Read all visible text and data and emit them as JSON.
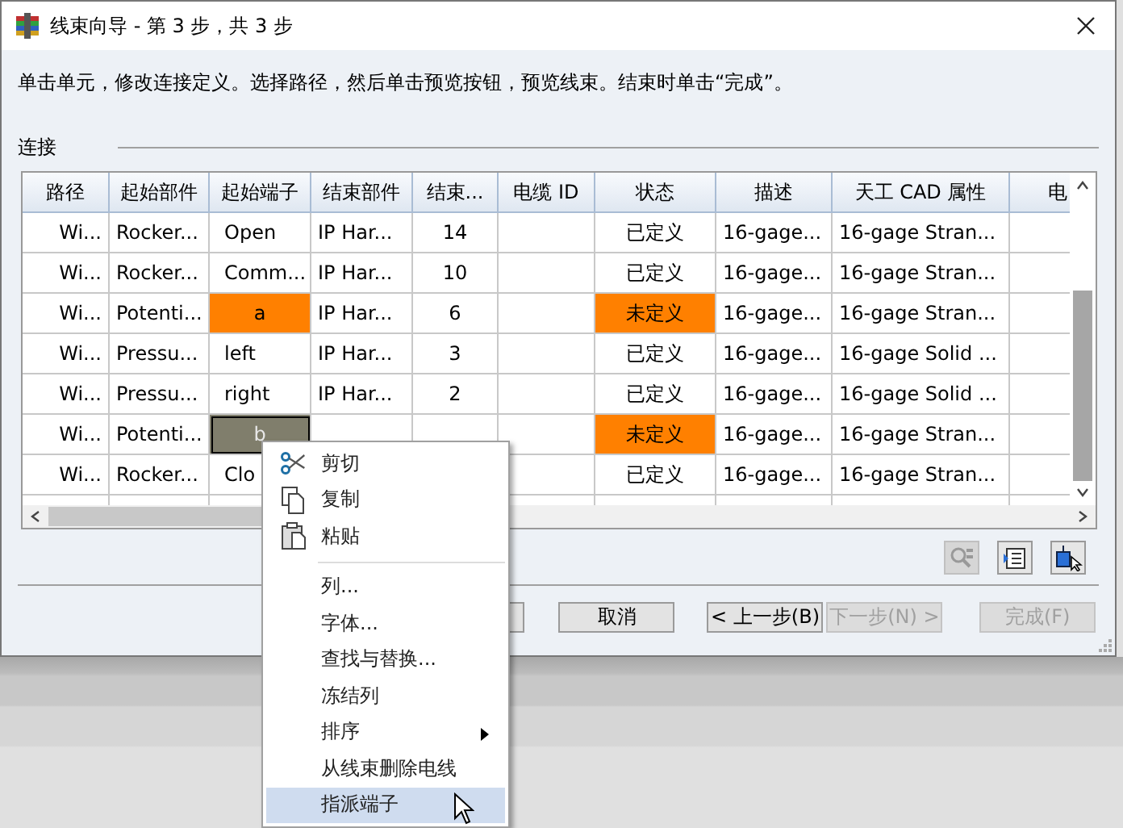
{
  "window": {
    "title": "线束向导 - 第 3 步，共 3 步"
  },
  "instruction": "单击单元，修改连接定义。选择路径，然后单击预览按钮，预览线束。结束时单击“完成”。",
  "section_label": "连接",
  "table": {
    "columns": [
      "路径",
      "起始部件",
      "起始端子",
      "结束部件",
      "结束...",
      "电缆 ID",
      "状态",
      "描述",
      "天工 CAD 属性",
      "电"
    ],
    "rows": [
      {
        "selected": false,
        "defined": true,
        "cells": [
          "Wi...",
          "Rocker...",
          "Open",
          "IP Har...",
          "14",
          "",
          "已定义",
          "16-gage...",
          "16-gage Stran...",
          ""
        ]
      },
      {
        "selected": false,
        "defined": true,
        "cells": [
          "Wi...",
          "Rocker...",
          "Comm...",
          "IP Har...",
          "10",
          "",
          "已定义",
          "16-gage...",
          "16-gage Stran...",
          ""
        ]
      },
      {
        "selected": false,
        "defined": false,
        "cells": [
          "Wi...",
          "Potenti...",
          "a",
          "IP Har...",
          "6",
          "",
          "未定义",
          "16-gage...",
          "16-gage Stran...",
          ""
        ]
      },
      {
        "selected": false,
        "defined": true,
        "cells": [
          "Wi...",
          "Pressu...",
          "left",
          "IP Har...",
          "3",
          "",
          "已定义",
          "16-gage...",
          "16-gage Solid ...",
          ""
        ]
      },
      {
        "selected": false,
        "defined": true,
        "cells": [
          "Wi...",
          "Pressu...",
          "right",
          "IP Har...",
          "2",
          "",
          "已定义",
          "16-gage...",
          "16-gage Solid ...",
          ""
        ]
      },
      {
        "selected": true,
        "defined": false,
        "cells": [
          "Wi...",
          "Potenti...",
          "b",
          null,
          null,
          "",
          "未定义",
          "16-gage...",
          "16-gage Stran...",
          ""
        ]
      },
      {
        "selected": false,
        "defined": true,
        "cells": [
          "Wi...",
          "Rocker...",
          "Clo",
          null,
          null,
          "",
          "已定义",
          "16-gage...",
          "16-gage Stran...",
          ""
        ]
      }
    ]
  },
  "buttons": [
    {
      "label": "取消",
      "disabled": false
    },
    {
      "label": "< 上一步(B)",
      "disabled": false
    },
    {
      "label": "下一步(N) >",
      "disabled": true
    },
    {
      "label": "完成(F)",
      "disabled": true
    }
  ],
  "context_menu": {
    "groups": [
      [
        {
          "label": "剪切",
          "selected": false,
          "submenu": false
        },
        {
          "label": "复制",
          "selected": false,
          "submenu": false
        },
        {
          "label": "粘贴",
          "selected": false,
          "submenu": false
        }
      ],
      [
        {
          "label": "列...",
          "selected": false,
          "submenu": false
        },
        {
          "label": "字体...",
          "selected": false,
          "submenu": false
        },
        {
          "label": "查找与替换...",
          "selected": false,
          "submenu": false
        },
        {
          "label": "冻结列",
          "selected": false,
          "submenu": false
        },
        {
          "label": "排序",
          "selected": false,
          "submenu": true
        },
        {
          "label": "从线束删除电线",
          "selected": false,
          "submenu": false
        },
        {
          "label": "指派端子",
          "selected": true,
          "submenu": false
        }
      ]
    ]
  }
}
